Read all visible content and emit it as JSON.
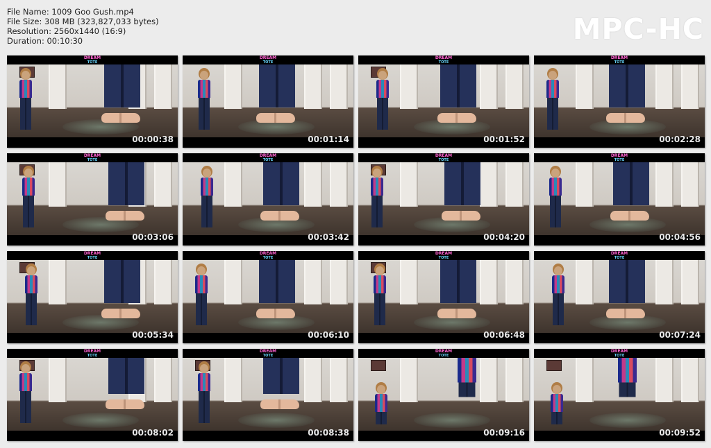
{
  "header": {
    "file_name": "File Name: 1009 Goo Gush.mp4",
    "file_size": "File Size: 308 MB (323,827,033 bytes)",
    "resolution": "Resolution: 2560x1440 (16:9)",
    "duration": "Duration: 00:10:30"
  },
  "logo": "MPC-HC",
  "watermark": {
    "line1": "DREAM",
    "line2": "ТОТЕ"
  },
  "thumbnails": [
    {
      "timestamp": "00:00:38"
    },
    {
      "timestamp": "00:01:14"
    },
    {
      "timestamp": "00:01:52"
    },
    {
      "timestamp": "00:02:28"
    },
    {
      "timestamp": "00:03:06"
    },
    {
      "timestamp": "00:03:42"
    },
    {
      "timestamp": "00:04:20"
    },
    {
      "timestamp": "00:04:56"
    },
    {
      "timestamp": "00:05:34"
    },
    {
      "timestamp": "00:06:10"
    },
    {
      "timestamp": "00:06:48"
    },
    {
      "timestamp": "00:07:24"
    },
    {
      "timestamp": "00:08:02"
    },
    {
      "timestamp": "00:08:38"
    },
    {
      "timestamp": "00:09:16"
    },
    {
      "timestamp": "00:09:52"
    }
  ]
}
